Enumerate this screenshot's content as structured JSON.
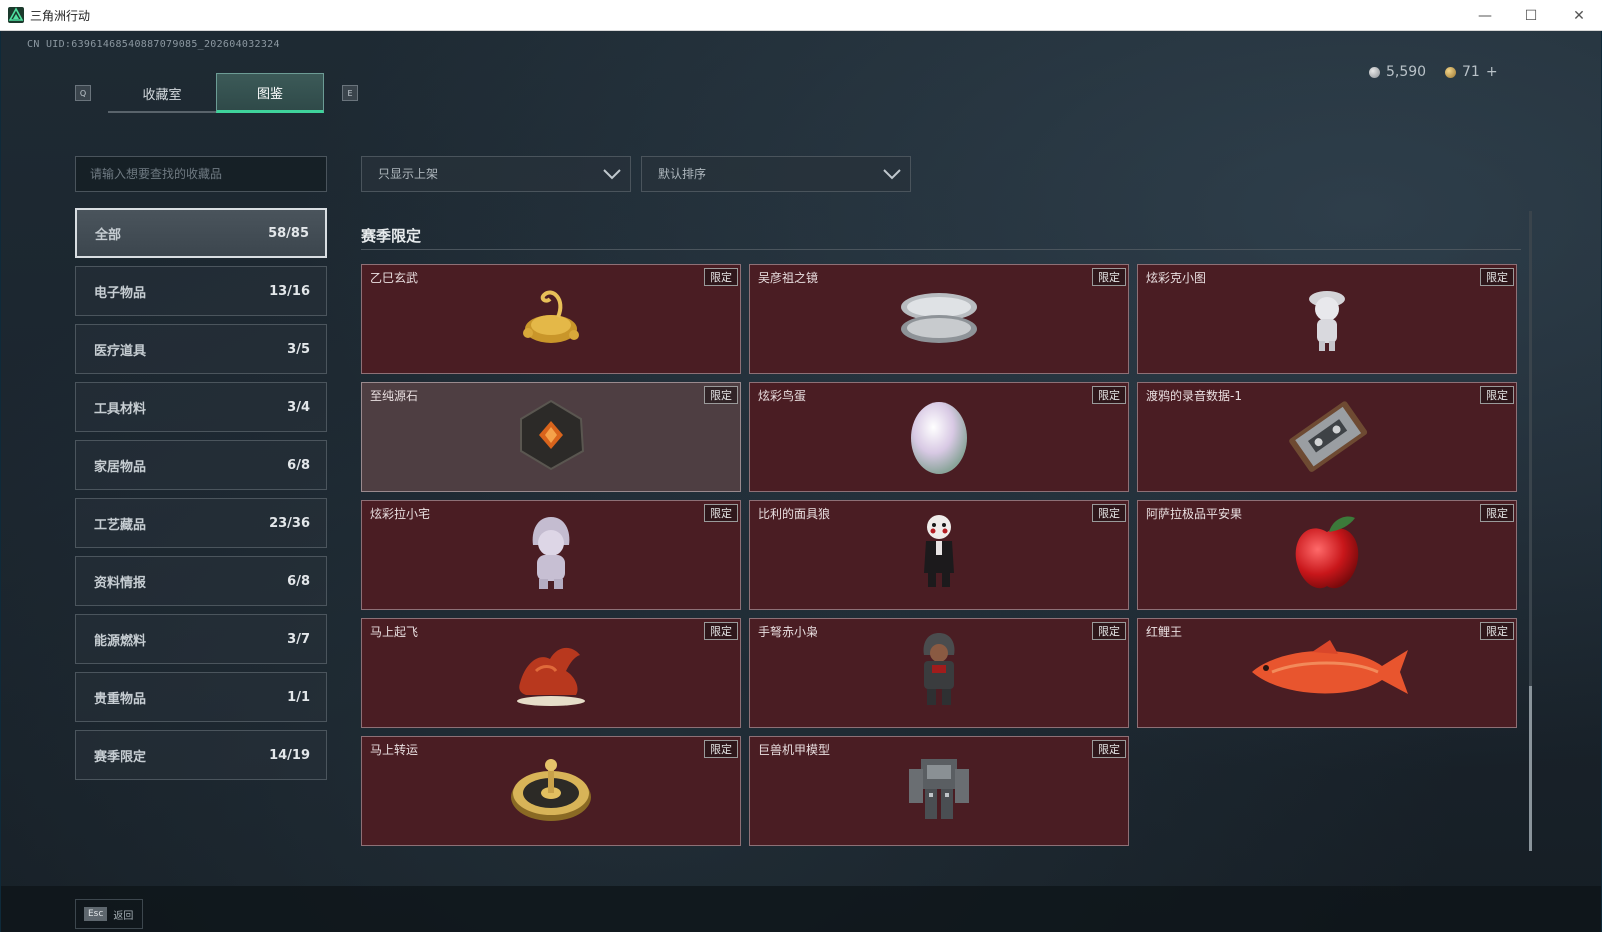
{
  "window": {
    "title": "三角洲行动",
    "minimize_icon": "minimize-icon",
    "maximize_icon": "maximize-icon",
    "close_icon": "close-icon"
  },
  "header": {
    "uid": "CN UID:6396146854088707908​5_202604032324",
    "currency_silver": "5,590",
    "currency_gold": "71",
    "gold_plus": "+"
  },
  "tabs": {
    "prev_key": "Q",
    "next_key": "E",
    "items": [
      {
        "label": "收藏室"
      },
      {
        "label": "图鉴"
      }
    ],
    "active": 1
  },
  "search": {
    "placeholder": "请输入想要查找的收藏品"
  },
  "filters": {
    "shelf": "只显示上架",
    "sort": "默认排序"
  },
  "categories": [
    {
      "name": "全部",
      "count": "58/85"
    },
    {
      "name": "电子物品",
      "count": "13/16"
    },
    {
      "name": "医疗道具",
      "count": "3/5"
    },
    {
      "name": "工具材料",
      "count": "3/4"
    },
    {
      "name": "家居物品",
      "count": "6/8"
    },
    {
      "name": "工艺藏品",
      "count": "23/36"
    },
    {
      "name": "资料情报",
      "count": "6/8"
    },
    {
      "name": "能源燃料",
      "count": "3/7"
    },
    {
      "name": "贵重物品",
      "count": "1/1"
    },
    {
      "name": "赛季限定",
      "count": "14/19"
    }
  ],
  "section": {
    "title": "赛季限定"
  },
  "items": [
    {
      "name": "乙巳玄武",
      "tag": "限定",
      "icon": "golden-dragon-turtle-icon"
    },
    {
      "name": "吴彦祖之镜",
      "tag": "限定",
      "icon": "compact-mirror-icon"
    },
    {
      "name": "炫彩克小图",
      "tag": "限定",
      "icon": "white-figurine-icon"
    },
    {
      "name": "至纯源石",
      "tag": "限定",
      "icon": "dark-crystal-icon"
    },
    {
      "name": "炫彩鸟蛋",
      "tag": "限定",
      "icon": "iridescent-egg-icon"
    },
    {
      "name": "渡鸦的录音数据-1",
      "tag": "限定",
      "icon": "cassette-tape-icon"
    },
    {
      "name": "炫彩拉小宅",
      "tag": "限定",
      "icon": "hooded-figurine-icon"
    },
    {
      "name": "比利的面具狼",
      "tag": "限定",
      "icon": "puppet-doll-icon"
    },
    {
      "name": "阿萨拉极品平安果",
      "tag": "限定",
      "icon": "red-apple-icon"
    },
    {
      "name": "马上起飞",
      "tag": "限定",
      "icon": "horse-statue-icon"
    },
    {
      "name": "手弩赤小枭",
      "tag": "限定",
      "icon": "hooded-soldier-icon"
    },
    {
      "name": "红鲤王",
      "tag": "限定",
      "icon": "red-carp-icon"
    },
    {
      "name": "马上转运",
      "tag": "限定",
      "icon": "golden-disc-icon"
    },
    {
      "name": "巨兽机甲模型",
      "tag": "限定",
      "icon": "mech-model-icon"
    }
  ],
  "footer": {
    "esc_key": "Esc",
    "back_label": "返回"
  },
  "colors": {
    "accent": "#3fd39c",
    "card_bg": "#4a1d23",
    "card_hover": "#4e3e42"
  }
}
